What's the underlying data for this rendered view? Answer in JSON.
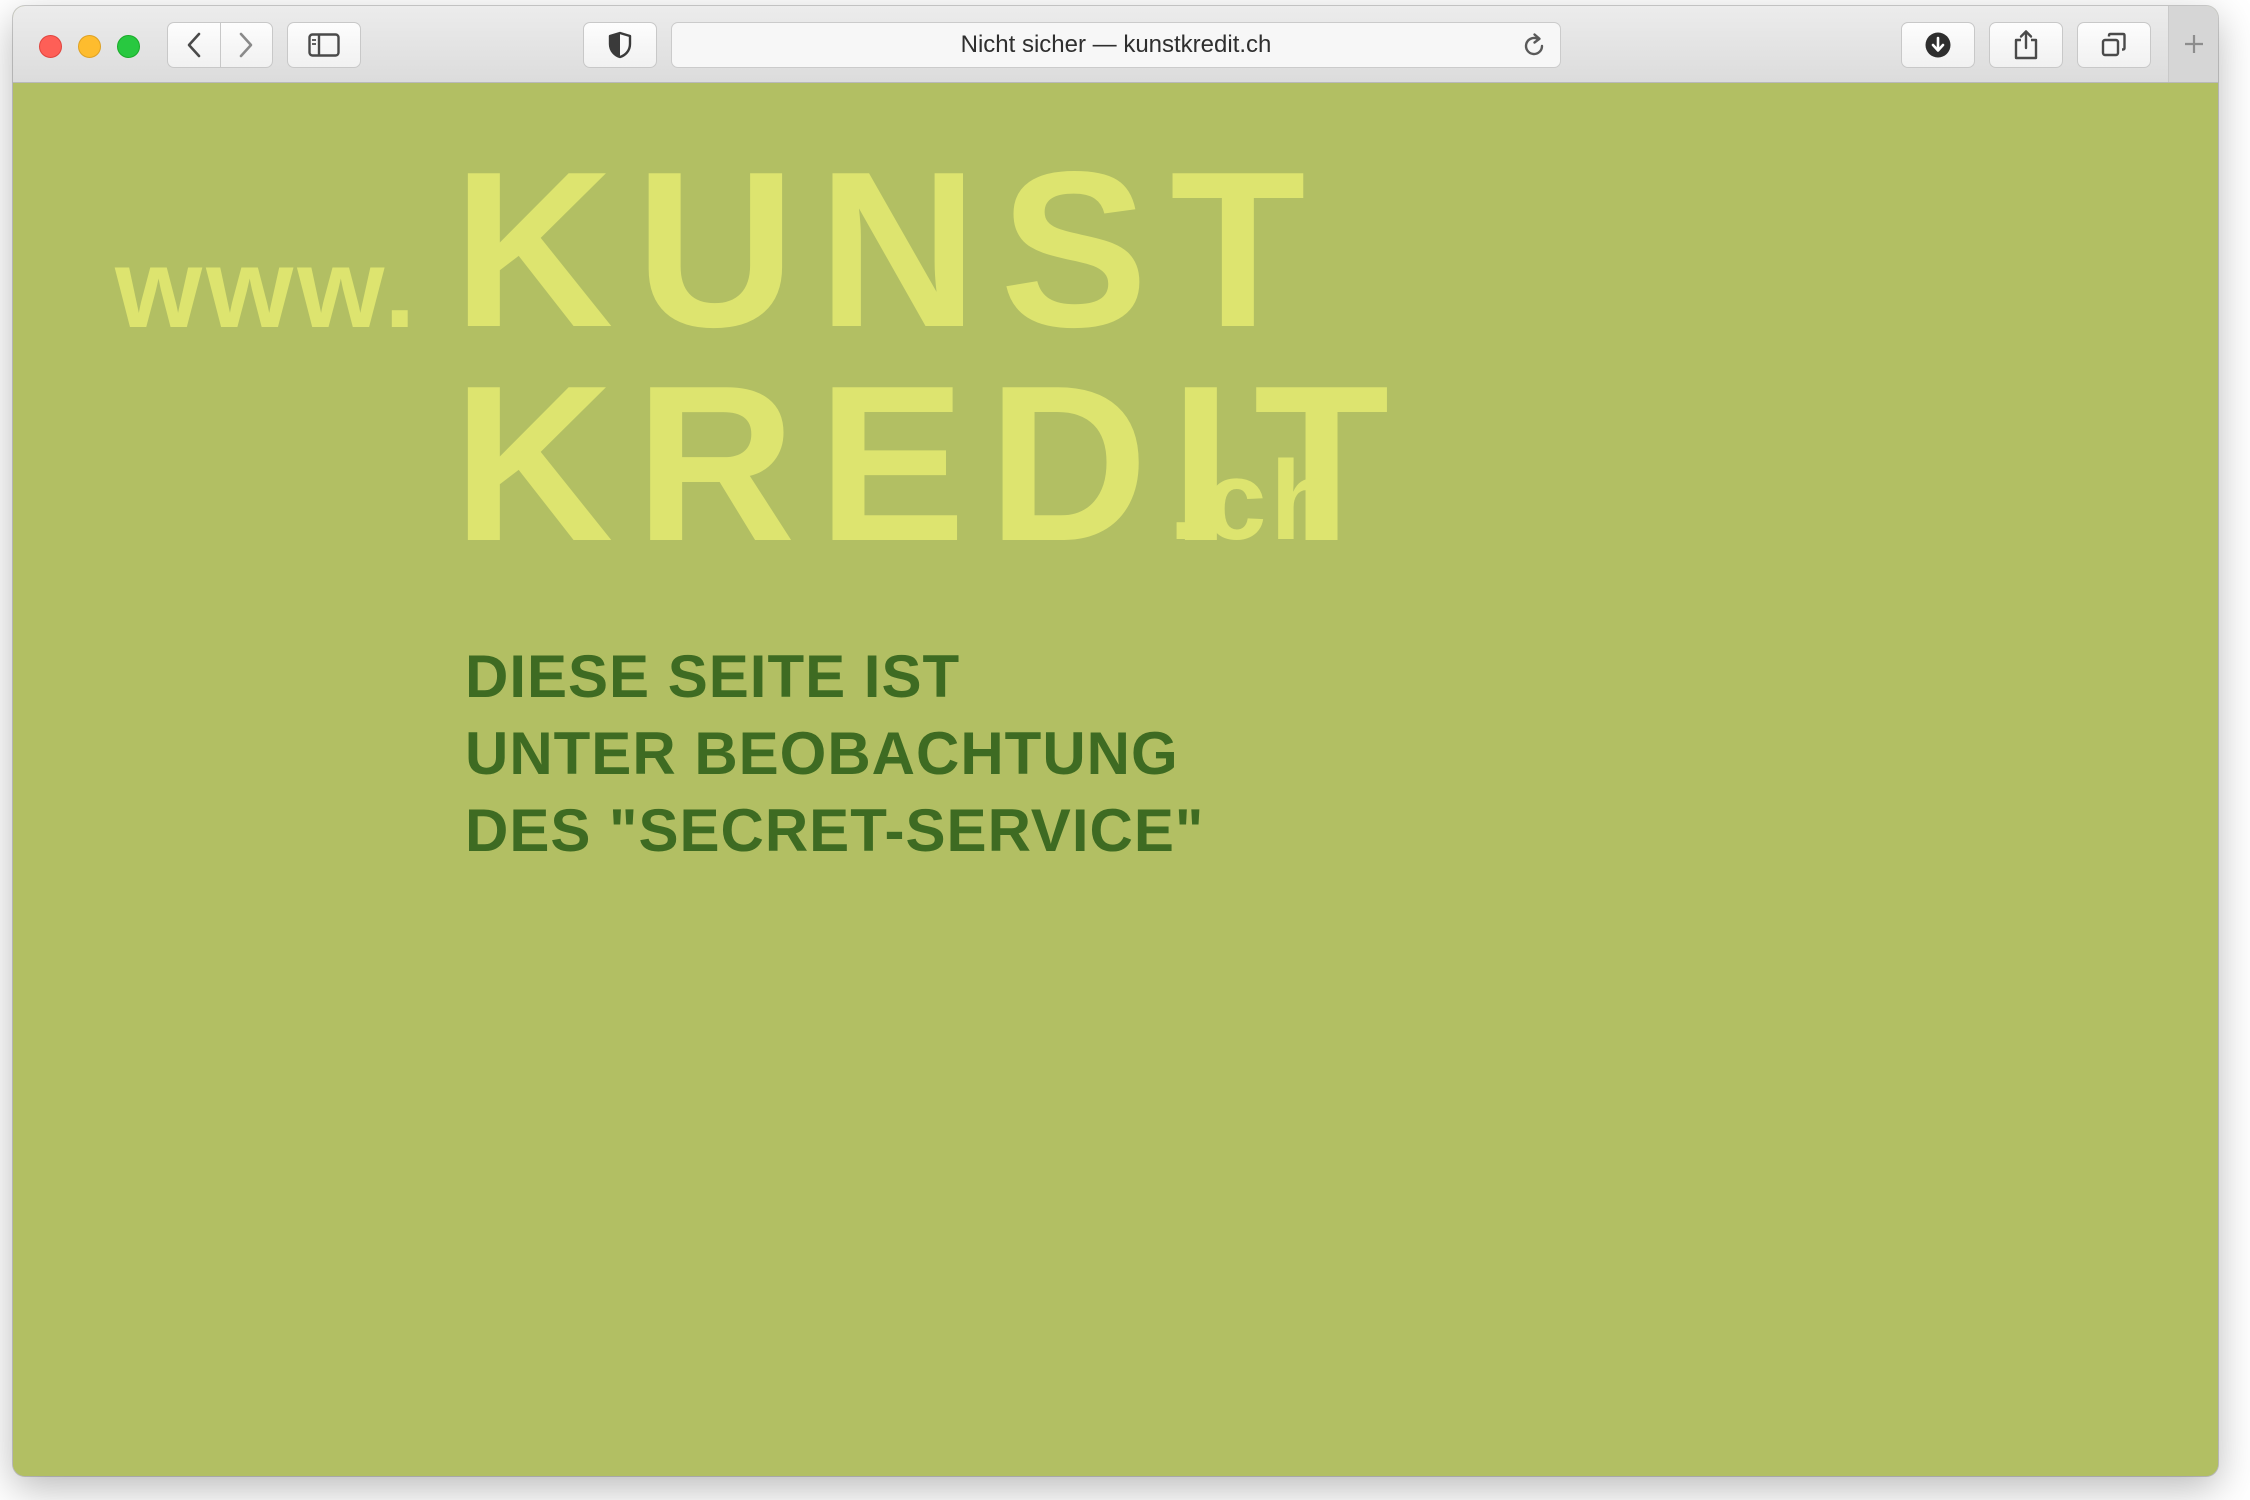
{
  "browser": {
    "address_bar": {
      "text": "Nicht sicher — kunstkredit.ch"
    },
    "icons": {
      "back": "chevron-left-icon",
      "forward": "chevron-right-icon",
      "sidebar": "sidebar-icon",
      "privacy": "shield-icon",
      "reload": "reload-icon",
      "downloads": "download-icon",
      "share": "share-icon",
      "tabs": "tabs-overview-icon",
      "new_tab": "plus-icon"
    }
  },
  "page": {
    "logo": {
      "prefix": "www.",
      "line1": "KUNST",
      "line2": "KREDIT",
      "suffix": ".ch"
    },
    "message": {
      "line1": "DIESE SEITE IST",
      "line2": "UNTER BEOBACHTUNG",
      "line3": "DES \"SECRET-SERVICE\""
    }
  },
  "colors": {
    "background": "#b2bf63",
    "logo": "#dde46f",
    "message": "#3e6b22"
  }
}
